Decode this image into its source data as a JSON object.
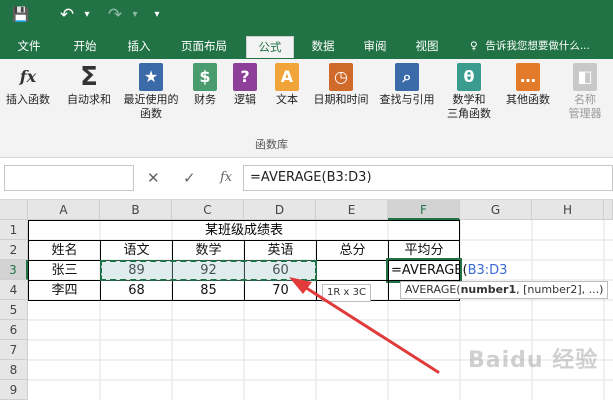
{
  "quick_access": {
    "save_icon": "💾",
    "undo_icon": "↶",
    "redo_icon": "↷",
    "more_icon": "▾"
  },
  "tabs": [
    {
      "label": "文件",
      "active": false
    },
    {
      "label": "开始",
      "active": false
    },
    {
      "label": "插入",
      "active": false
    },
    {
      "label": "页面布局",
      "active": false
    },
    {
      "label": "公式",
      "active": true
    },
    {
      "label": "数据",
      "active": false
    },
    {
      "label": "审阅",
      "active": false
    },
    {
      "label": "视图",
      "active": false
    }
  ],
  "tell_me": "告诉我您想要做什么...",
  "ribbon": {
    "buttons": [
      {
        "label": "插入函数",
        "icon": "fx"
      },
      {
        "label": "自动求和",
        "icon": "Σ"
      },
      {
        "label": "最近使用的",
        "sub": "函数",
        "icon": "★"
      },
      {
        "label": "财务",
        "icon": "$"
      },
      {
        "label": "逻辑",
        "icon": "?"
      },
      {
        "label": "文本",
        "icon": "A"
      },
      {
        "label": "日期和时间",
        "icon": "◷"
      },
      {
        "label": "查找与引用",
        "icon": "⌕"
      },
      {
        "label": "数学和",
        "sub": "三角函数",
        "icon": "θ"
      },
      {
        "label": "其他函数",
        "icon": "…"
      },
      {
        "label": "名称",
        "sub": "管理器",
        "icon": "◧"
      }
    ],
    "group_label": "函数库"
  },
  "formula_bar": {
    "cancel": "✕",
    "confirm": "✓",
    "fx": "fx",
    "formula": "=AVERAGE(B3:D3)"
  },
  "columns": [
    "A",
    "B",
    "C",
    "D",
    "E",
    "F",
    "G",
    "H"
  ],
  "rows": [
    "1",
    "2",
    "3",
    "4",
    "5",
    "6",
    "7",
    "8",
    "9"
  ],
  "sheet": {
    "title": "某班级成绩表",
    "headers": [
      "姓名",
      "语文",
      "数学",
      "英语",
      "总分",
      "平均分"
    ],
    "row3": [
      "张三",
      "89",
      "92",
      "60"
    ],
    "row4": [
      "李四",
      "68",
      "85",
      "70"
    ],
    "editing_prefix": "=AVERAGE(",
    "editing_range": "B3:D3",
    "range_tip": "1R x 3C",
    "func_tip_name": "AVERAGE(",
    "func_tip_bold": "number1",
    "func_tip_rest": ", [number2], ...)"
  },
  "watermark": "Baidu 经验",
  "colors": {
    "brand": "#217346",
    "marquee": "#1e7145",
    "arrow": "#e03a3a",
    "range_text": "#3a6ad8"
  }
}
